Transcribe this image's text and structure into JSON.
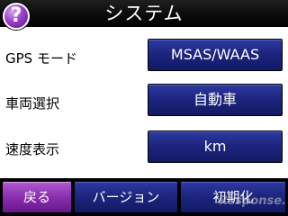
{
  "header": {
    "help_icon_glyph": "?",
    "title": "システム"
  },
  "settings": {
    "gps_mode": {
      "label": "GPS モード",
      "value": "MSAS/WAAS"
    },
    "vehicle": {
      "label": "車両選択",
      "value": "自動車"
    },
    "speed_unit": {
      "label": "速度表示",
      "value": "km"
    }
  },
  "footer": {
    "back_label": "戻る",
    "version_label": "バージョン",
    "reset_label": "初期化"
  },
  "watermark": "Response.",
  "colors": {
    "header_bg": "#000000",
    "button_blue": "#1d2580",
    "button_purple": "#8a2fb0",
    "help_purple": "#9b3fcf"
  }
}
